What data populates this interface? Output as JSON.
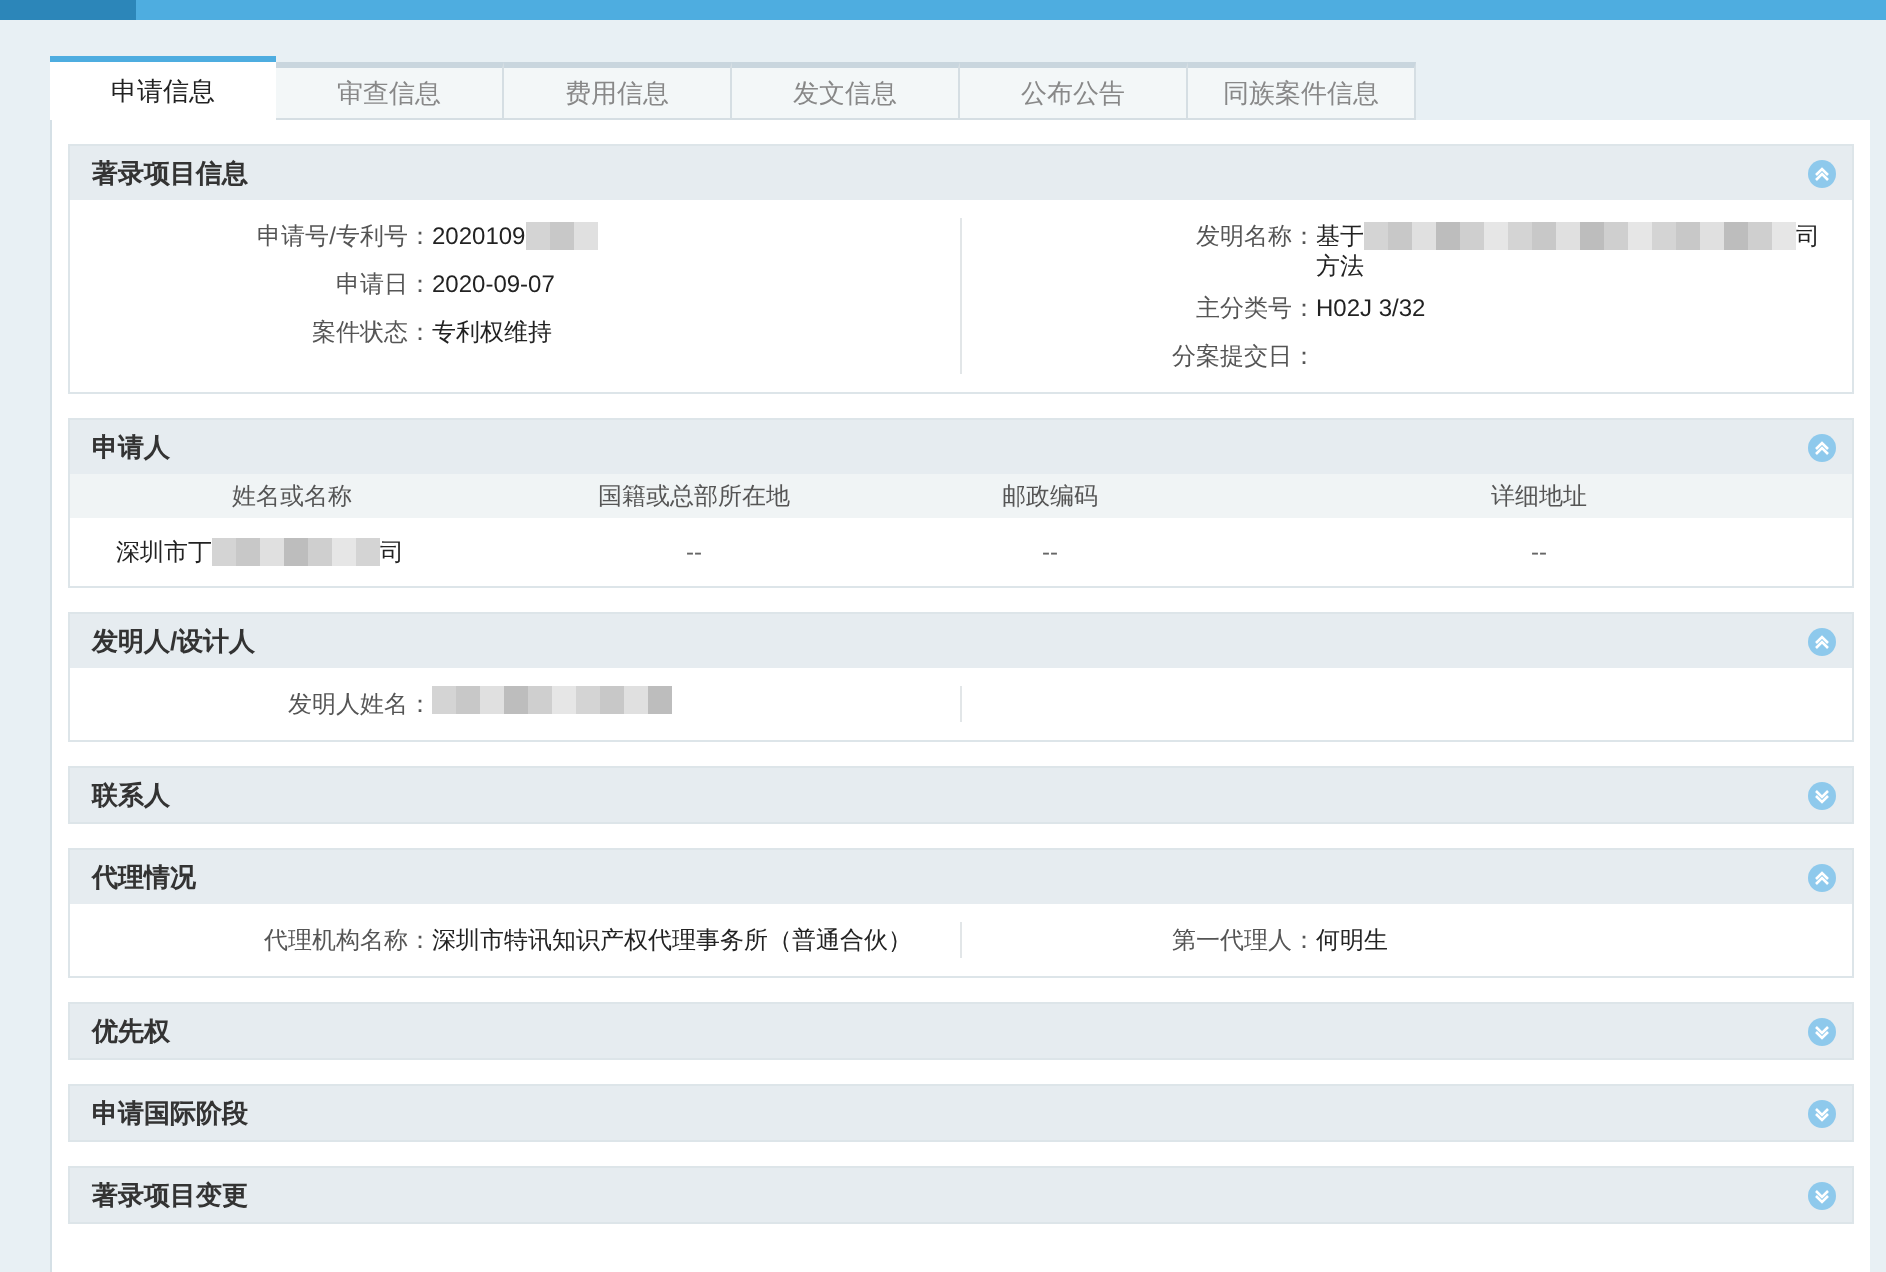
{
  "tabs": [
    {
      "label": "申请信息",
      "selected": true
    },
    {
      "label": "审查信息",
      "selected": false
    },
    {
      "label": "费用信息",
      "selected": false
    },
    {
      "label": "发文信息",
      "selected": false
    },
    {
      "label": "公布公告",
      "selected": false
    },
    {
      "label": "同族案件信息",
      "selected": false
    }
  ],
  "sections": [
    {
      "title": "著录项目信息",
      "expanded": true,
      "kind": "fields",
      "left": [
        {
          "label": "申请号/专利号：",
          "value": "2020109",
          "redacted": true
        },
        {
          "label": "申请日：",
          "value": "2020-09-07"
        },
        {
          "label": "案件状态：",
          "value": "专利权维持"
        }
      ],
      "right": [
        {
          "label": "发明名称：",
          "value": "基于",
          "redacted": true,
          "value_end": "司",
          "value_line2": "方法"
        },
        {
          "label": "主分类号：",
          "value": "H02J 3/32"
        },
        {
          "label": "分案提交日："
        }
      ]
    },
    {
      "title": "申请人",
      "expanded": true,
      "kind": "table",
      "columns": [
        "姓名或名称",
        "国籍或总部所在地",
        "邮政编码",
        "详细地址"
      ],
      "rows": [
        [
          {
            "value": "深圳市丁",
            "redacted": true,
            "value_end": "司"
          },
          {
            "value": "--"
          },
          {
            "value": "--"
          },
          {
            "value": "--"
          }
        ]
      ]
    },
    {
      "title": "发明人/设计人",
      "expanded": true,
      "kind": "fields",
      "left": [
        {
          "label": "发明人姓名：",
          "redacted": true
        }
      ]
    },
    {
      "title": "联系人",
      "expanded": false
    },
    {
      "title": "代理情况",
      "expanded": true,
      "kind": "fields",
      "left": [
        {
          "label": "代理机构名称：",
          "value": "深圳市特讯知识产权代理事务所（普通合伙）"
        }
      ],
      "right": [
        {
          "label": "第一代理人：",
          "value": "何明生"
        }
      ]
    },
    {
      "title": "优先权",
      "expanded": false
    },
    {
      "title": "申请国际阶段",
      "expanded": false
    },
    {
      "title": "著录项目变更",
      "expanded": false
    }
  ]
}
